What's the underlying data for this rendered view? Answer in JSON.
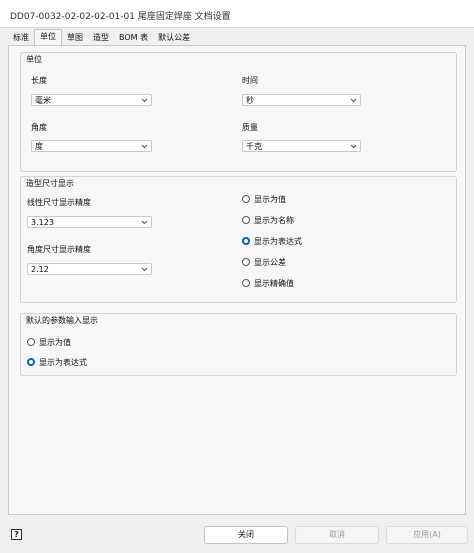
{
  "window": {
    "title": "DD07-0032-02-02-02-01-01 尾座固定焊座 文档设置"
  },
  "tabs": [
    {
      "label": "标准",
      "active": false
    },
    {
      "label": "单位",
      "active": true
    },
    {
      "label": "草图",
      "active": false
    },
    {
      "label": "造型",
      "active": false
    },
    {
      "label": "BOM 表",
      "active": false
    },
    {
      "label": "默认公差",
      "active": false
    }
  ],
  "units": {
    "group_title": "单位",
    "length_label": "长度",
    "length_value": "毫米",
    "time_label": "时间",
    "time_value": "秒",
    "angle_label": "角度",
    "angle_value": "度",
    "mass_label": "质量",
    "mass_value": "千克"
  },
  "dimension_display": {
    "group_title": "造型尺寸显示",
    "linear_precision_label": "线性尺寸显示精度",
    "linear_precision_value": "3.123",
    "angular_precision_label": "角度尺寸显示精度",
    "angular_precision_value": "2.12",
    "options": [
      {
        "label": "显示为值",
        "selected": false
      },
      {
        "label": "显示为名称",
        "selected": false
      },
      {
        "label": "显示为表达式",
        "selected": true
      },
      {
        "label": "显示公差",
        "selected": false
      },
      {
        "label": "显示精确值",
        "selected": false
      }
    ]
  },
  "parameter_input": {
    "group_title": "默认的参数输入显示",
    "options": [
      {
        "label": "显示为值",
        "selected": false
      },
      {
        "label": "显示为表达式",
        "selected": true
      }
    ]
  },
  "footer": {
    "help_label": "?",
    "close_label": "关闭",
    "cancel_label": "取消",
    "apply_label": "应用(A)"
  },
  "colors": {
    "accent": "#0067c0",
    "background": "#f0f0f0",
    "panel": "#f7f7f7"
  }
}
